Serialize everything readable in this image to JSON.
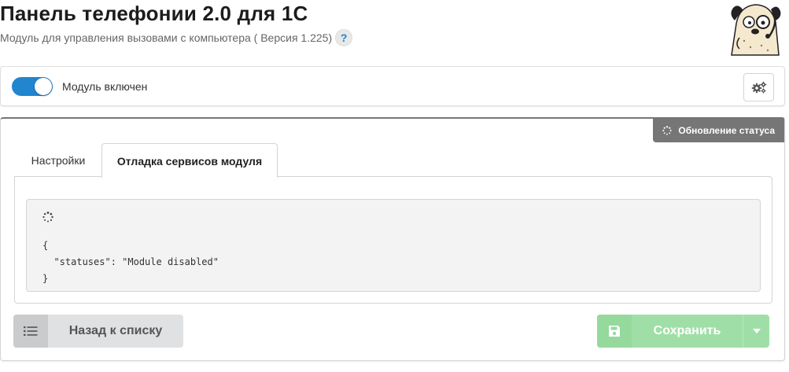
{
  "header": {
    "title": "Панель телефонии 2.0 для 1С",
    "subtitle": "Модуль для управления вызовами с компьютера ( Версия 1.225)",
    "help_label": "?"
  },
  "module": {
    "enabled": true,
    "label": "Модуль включен",
    "accent_color": "#2185d0"
  },
  "status": {
    "label": "Обновление статуса"
  },
  "tabs": [
    {
      "label": "Настройки",
      "active": false
    },
    {
      "label": "Отладка сервисов модуля",
      "active": true
    }
  ],
  "debug": {
    "output": "{\n  \"statuses\": \"Module disabled\"\n}"
  },
  "actions": {
    "back_label": "Назад к списку",
    "save_label": "Сохранить",
    "save_color": "#9fdfa7"
  },
  "icons": {
    "help": "question-icon",
    "settings": "gears-icon",
    "status": "spinner-icon",
    "back": "list-icon",
    "save": "floppy-disk-icon",
    "dropdown": "caret-down-icon"
  }
}
